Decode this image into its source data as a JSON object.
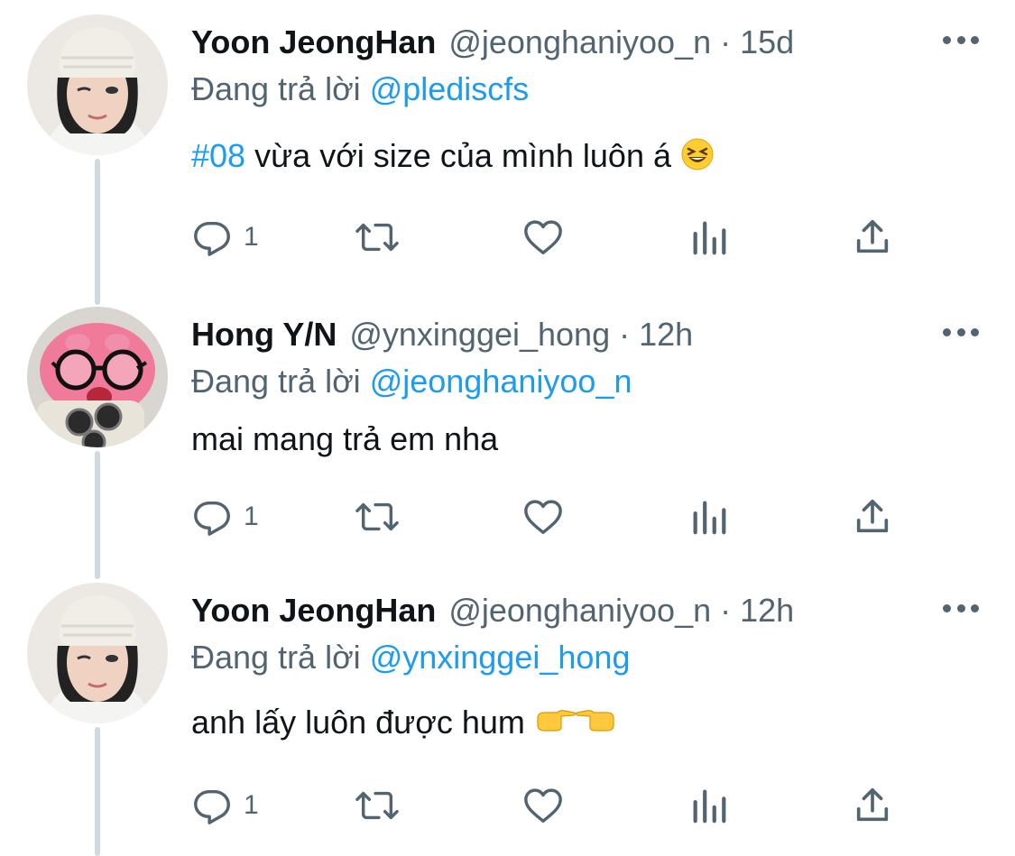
{
  "tweets": [
    {
      "name": "Yoon JeongHan",
      "handle": "@jeonghaniyoo_n",
      "time": "15d",
      "reply_label": "Đang trả lời",
      "reply_to": "@pledis​cfs",
      "hashtag": "#08",
      "text": " vừa với size của mình luôn á ",
      "emoji": "laughing-face",
      "reply_count": "1"
    },
    {
      "name": "Hong Y/N",
      "handle": "@ynxinggei_hong",
      "time": "12h",
      "reply_label": "Đang trả lời",
      "reply_to": "@jeonghaniyoo_n",
      "text": "mai mang trả em nha",
      "reply_count": "1"
    },
    {
      "name": "Yoon JeongHan",
      "handle": "@jeonghaniyoo_n",
      "time": "12h",
      "reply_label": "Đang trả lời",
      "reply_to": "@ynxinggei_hong",
      "text": "anh lấy luôn được hum ",
      "emoji": "pointing-hands",
      "reply_count": "1"
    }
  ],
  "colors": {
    "link": "#1d9bf0",
    "secondary": "#536471",
    "thread_line": "#cfd9de"
  },
  "icons": [
    "reply-icon",
    "retweet-icon",
    "like-icon",
    "views-icon",
    "share-icon",
    "more-icon"
  ]
}
